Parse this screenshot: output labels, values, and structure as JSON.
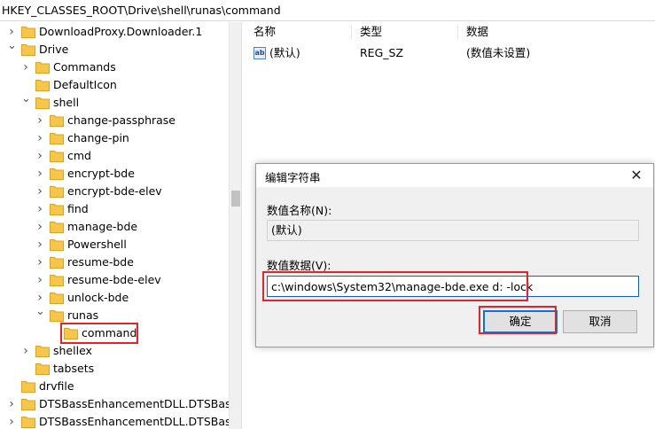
{
  "address": "HKEY_CLASSES_ROOT\\Drive\\shell\\runas\\command",
  "tree": [
    {
      "label": "DownloadProxy.Downloader.1",
      "depth": 0,
      "expander": "collapsed"
    },
    {
      "label": "Drive",
      "depth": 0,
      "expander": "expanded"
    },
    {
      "label": "Commands",
      "depth": 1,
      "expander": "collapsed"
    },
    {
      "label": "DefaultIcon",
      "depth": 1,
      "expander": "none"
    },
    {
      "label": "shell",
      "depth": 1,
      "expander": "expanded"
    },
    {
      "label": "change-passphrase",
      "depth": 2,
      "expander": "collapsed"
    },
    {
      "label": "change-pin",
      "depth": 2,
      "expander": "collapsed"
    },
    {
      "label": "cmd",
      "depth": 2,
      "expander": "collapsed"
    },
    {
      "label": "encrypt-bde",
      "depth": 2,
      "expander": "collapsed"
    },
    {
      "label": "encrypt-bde-elev",
      "depth": 2,
      "expander": "collapsed"
    },
    {
      "label": "find",
      "depth": 2,
      "expander": "collapsed"
    },
    {
      "label": "manage-bde",
      "depth": 2,
      "expander": "collapsed"
    },
    {
      "label": "Powershell",
      "depth": 2,
      "expander": "collapsed"
    },
    {
      "label": "resume-bde",
      "depth": 2,
      "expander": "collapsed"
    },
    {
      "label": "resume-bde-elev",
      "depth": 2,
      "expander": "collapsed"
    },
    {
      "label": "unlock-bde",
      "depth": 2,
      "expander": "collapsed"
    },
    {
      "label": "runas",
      "depth": 2,
      "expander": "expanded"
    },
    {
      "label": "command",
      "depth": 3,
      "expander": "none",
      "selected": true
    },
    {
      "label": "shellex",
      "depth": 1,
      "expander": "collapsed"
    },
    {
      "label": "tabsets",
      "depth": 1,
      "expander": "none"
    },
    {
      "label": "drvfile",
      "depth": 0,
      "expander": "none"
    },
    {
      "label": "DTSBassEnhancementDLL.DTSBassEnha",
      "depth": 0,
      "expander": "collapsed"
    },
    {
      "label": "DTSBassEnhancementDLL.DTSBassEnha",
      "depth": 0,
      "expander": "collapsed"
    }
  ],
  "list": {
    "columns": {
      "name": "名称",
      "type": "类型",
      "data": "数据"
    },
    "rows": [
      {
        "name": "(默认)",
        "type": "REG_SZ",
        "data": "(数值未设置)",
        "icon": "string-value-icon"
      }
    ]
  },
  "dialog": {
    "title": "编辑字符串",
    "name_label": "数值名称(N):",
    "name_value": "(默认)",
    "data_label": "数值数据(V):",
    "data_value": "c:\\windows\\System32\\manage-bde.exe d: -lock",
    "ok_label": "确定",
    "cancel_label": "取消"
  },
  "colors": {
    "highlight": "#e0262a",
    "folder": "#f5c64a",
    "focus": "#0078d7"
  }
}
